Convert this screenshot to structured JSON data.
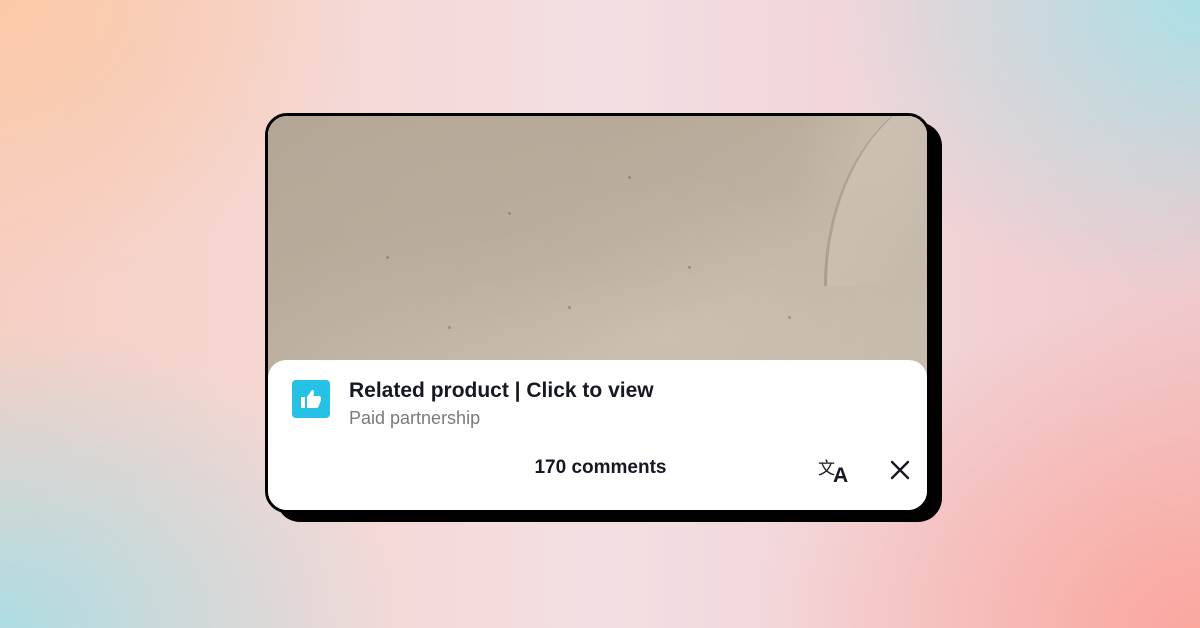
{
  "colors": {
    "accent": "#27c0e6",
    "title_text": "#161823",
    "subtitle_text": "#7a7b80",
    "card_border": "#000000"
  },
  "promo": {
    "icon": "thumbs-up-icon",
    "title": "Related product | Click to view",
    "subtitle": "Paid partnership"
  },
  "comments": {
    "count_label": "170 comments"
  },
  "actions": {
    "translate_icon": "translate-icon",
    "close_icon": "close-icon"
  }
}
